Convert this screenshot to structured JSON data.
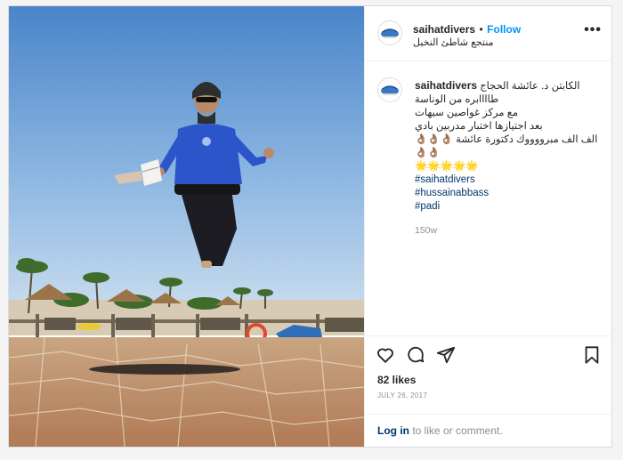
{
  "post": {
    "username": "saihatdivers",
    "separator": "•",
    "follow_label": "Follow",
    "location": "منتجع شاطئ النخيل",
    "more_label": "•••",
    "caption": {
      "username": "saihatdivers",
      "lines": [
        "الكابتن د. عائشة الحجاج",
        "طاااابره من الوناسة",
        "مع مركز غواصين سيهات",
        "بعد اجتيازها اختبار مدربين بادي",
        "الف الف مبرووووك دكتورة عائشة 👌🏽👌🏽👌🏽",
        "👌🏽👌🏽"
      ],
      "stars": "🌟🌟🌟🌟🌟",
      "hashtags": [
        "#saihatdivers",
        "#hussainabbass",
        "#padi"
      ],
      "age": "150w"
    },
    "likes": "82 likes",
    "date": "JULY 26, 2017",
    "login_link": "Log in",
    "login_text": " to like or comment."
  },
  "icons": {
    "like": "heart-outline-icon",
    "comment": "speech-bubble-icon",
    "share": "paper-plane-icon",
    "save": "bookmark-icon",
    "more": "ellipsis-icon"
  }
}
